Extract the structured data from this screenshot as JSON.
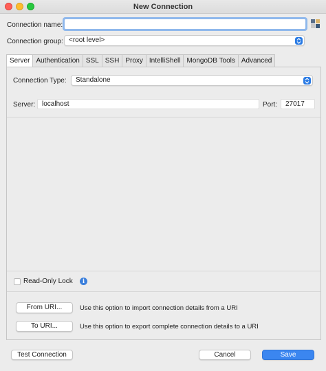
{
  "window": {
    "title": "New Connection"
  },
  "form": {
    "connection_name_label": "Connection name:",
    "connection_name_value": "",
    "connection_group_label": "Connection group:",
    "connection_group_value": "<root level>"
  },
  "tabs": [
    {
      "label": "Server",
      "active": true
    },
    {
      "label": "Authentication",
      "active": false
    },
    {
      "label": "SSL",
      "active": false
    },
    {
      "label": "SSH",
      "active": false
    },
    {
      "label": "Proxy",
      "active": false
    },
    {
      "label": "IntelliShell",
      "active": false
    },
    {
      "label": "MongoDB Tools",
      "active": false
    },
    {
      "label": "Advanced",
      "active": false
    }
  ],
  "server": {
    "connection_type_label": "Connection Type:",
    "connection_type_value": "Standalone",
    "server_label": "Server:",
    "server_value": "localhost",
    "port_label": "Port:",
    "port_value": "27017"
  },
  "options": {
    "readonly_label": "Read-Only Lock",
    "readonly_checked": false,
    "from_uri_label": "From URI...",
    "from_uri_desc": "Use this option to import connection details from a URI",
    "to_uri_label": "To URI...",
    "to_uri_desc": "Use this option to export complete connection details to a URI"
  },
  "footer": {
    "test_label": "Test Connection",
    "cancel_label": "Cancel",
    "save_label": "Save"
  },
  "colors": {
    "accent": "#3b86f0",
    "focus_ring": "#8fb8ec"
  }
}
